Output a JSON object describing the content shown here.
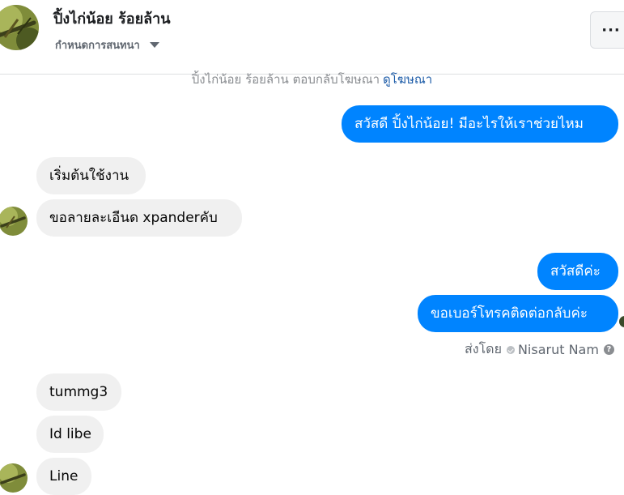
{
  "header": {
    "title": "ปิ้งไก่น้อย ร้อยล้าน",
    "subtitle": "กำหนดการสนทนา",
    "more_label": "···"
  },
  "notice": {
    "text": "ปิ้งไก่น้อย ร้อยล้าน ตอบกลับโฆษณา",
    "link": "ดูโฆษณา"
  },
  "messages": {
    "out_1": "สวัสดี ปิ้งไก่น้อย! มีอะไรให้เราช่วยไหม",
    "in_1": "เริ่มต้นใช้งาน",
    "in_2": "ขอลายละเอีนด xpanderคับ",
    "out_2": "สวัสดีค่ะ",
    "out_3": "ขอเบอร์โทรคติดต่อกลับค่ะ",
    "in_3": "tummg3",
    "in_4": "Id libe",
    "in_5": "Line"
  },
  "sent_by": {
    "prefix": "ส่งโดย",
    "name": "Nisarut Nam",
    "help": "?"
  },
  "colors": {
    "outgoing_bubble": "#0084ff",
    "incoming_bubble": "#f0f0f0",
    "link": "#1d5ca8"
  },
  "icons": {
    "avatar": "grasshopper-photo",
    "dropdown": "caret-down-icon",
    "more": "ellipsis-icon",
    "verified": "check-circle-icon",
    "help": "question-circle-icon"
  }
}
